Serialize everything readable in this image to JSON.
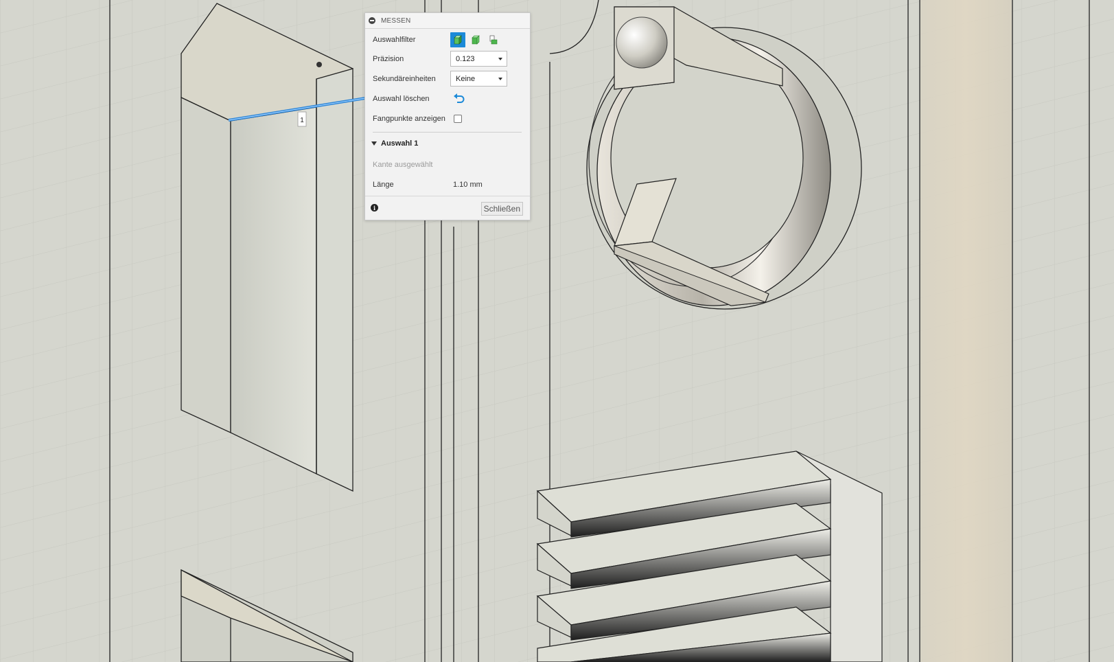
{
  "dialog": {
    "title": "MESSEN",
    "rows": {
      "selection_filter": "Auswahlfilter",
      "precision": "Präzision",
      "precision_value": "0.123",
      "secondary_units": "Sekundäreinheiten",
      "secondary_units_value": "Keine",
      "clear_selection": "Auswahl löschen",
      "show_snap_points": "Fangpunkte anzeigen"
    },
    "section": {
      "title": "Auswahl 1",
      "status": "Kante ausgewählt",
      "length_label": "Länge",
      "length_value": "1.10 mm"
    },
    "close_label": "Schließen"
  },
  "viewport": {
    "selection_marker": "1",
    "edge_highlight_color": "#2f86d6"
  },
  "colors": {
    "accent": "#1c8ad8",
    "background": "#d5d6ce"
  },
  "icons": {
    "collapse": "minus-circle-icon",
    "filter_body": "body-filter-icon",
    "filter_face": "face-filter-icon",
    "filter_edge": "edge-filter-icon",
    "clear": "undo-arrow-icon",
    "info": "info-icon"
  }
}
